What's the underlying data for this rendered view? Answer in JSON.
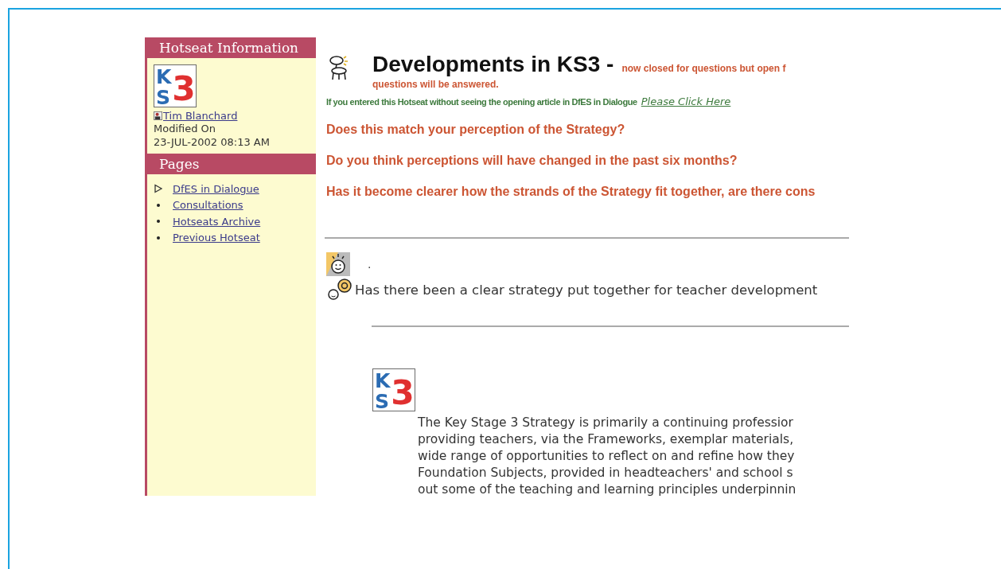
{
  "sidebar": {
    "info_title": "Hotseat Information",
    "logo": {
      "letters": [
        "K",
        "S",
        "3"
      ]
    },
    "author": "Tim Blanchard",
    "modified_label": "Modified On",
    "modified_date": "23-JUL-2002 08:13 AM",
    "pages_title": "Pages",
    "pages": [
      {
        "label": "DfES in Dialogue",
        "selected": true
      },
      {
        "label": "Consultations",
        "selected": false
      },
      {
        "label": "Hotseats Archive",
        "selected": false
      },
      {
        "label": "Previous Hotseat",
        "selected": false
      }
    ]
  },
  "main": {
    "title": "Developments in KS3 -",
    "subtitle_1": "now closed for questions but open f",
    "subtitle_2": "questions will be answered.",
    "notice": "If you entered this Hotseat without seeing the opening article in DfES in Dialogue",
    "notice_link": "Please Click Here",
    "questions": [
      "Does this match your perception of the Strategy?",
      "Do you think perceptions will have changed in the past six months?",
      "Has it become clearer how the strands of the Strategy fit together, are there cons"
    ],
    "answerer_text": ".",
    "question": "Has there been a clear strategy put together for teacher development",
    "article_logo": {
      "letters": [
        "K",
        "S",
        "3"
      ]
    },
    "article_lines": [
      "The Key Stage 3 Strategy is primarily a continuing professior",
      "providing teachers, via the Frameworks, exemplar materials,",
      "wide range of opportunities to reflect on and refine how they",
      "Foundation Subjects, provided in headteachers' and school s",
      "out some of the teaching and learning principles underpinnin"
    ]
  }
}
